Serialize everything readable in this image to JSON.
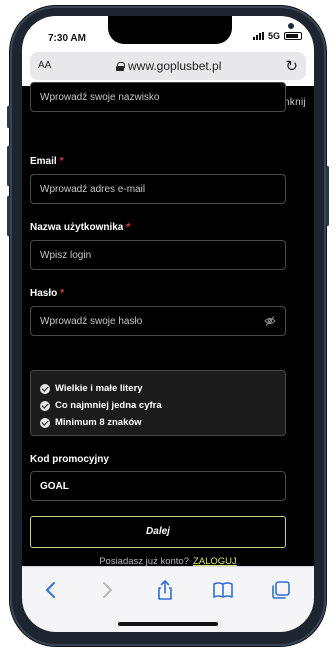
{
  "status_bar": {
    "time": "7:30 AM",
    "network": "5G"
  },
  "browser": {
    "text_size_label": "AA",
    "url": "www.goplusbet.pl"
  },
  "form": {
    "close_label": "Zamknij",
    "surname_placeholder": "Wprowadź swoje nazwisko",
    "email": {
      "label": "Email",
      "placeholder": "Wprowadź adres e-mail"
    },
    "username": {
      "label": "Nazwa użytkownika",
      "placeholder": "Wpisz login"
    },
    "password": {
      "label": "Hasło",
      "placeholder": "Wprowadź swoje hasło"
    },
    "required_mark": "*",
    "password_rules": [
      "Wielkie i małe litery",
      "Co najmniej jedna cyfra",
      "Minimum 8 znaków"
    ],
    "promo": {
      "label": "Kod promocyjny",
      "value": "GOAL"
    },
    "submit_label": "Dalej",
    "login_prompt": "Posiadasz już konto?",
    "login_link": "ZALOGUJ"
  },
  "colors": {
    "background": "#000000",
    "accent": "#d6e26a",
    "required": "#e53935"
  },
  "toolbar_icons": [
    "back-icon",
    "forward-icon",
    "share-icon",
    "bookmarks-icon",
    "tabs-icon"
  ]
}
